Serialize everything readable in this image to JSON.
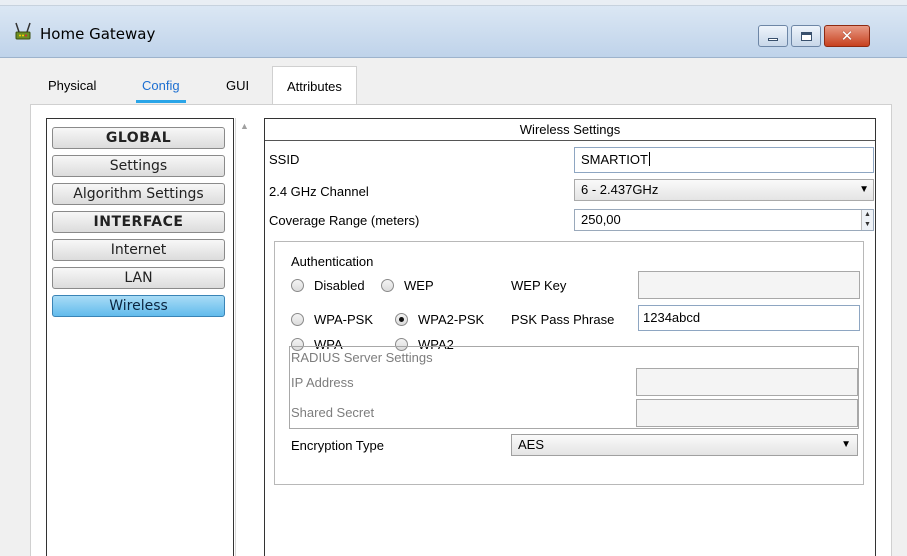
{
  "window": {
    "title": "Home Gateway",
    "icon": "router-icon",
    "controls": {
      "minimize": "minimize-icon",
      "maximize": "maximize-icon",
      "close": "✕"
    }
  },
  "tabs": [
    {
      "label": "Physical",
      "active": false
    },
    {
      "label": "Config",
      "active": true
    },
    {
      "label": "GUI",
      "active": false
    },
    {
      "label": "Attributes",
      "active": false
    }
  ],
  "sidebar": {
    "items": [
      {
        "label": "GLOBAL",
        "kind": "header"
      },
      {
        "label": "Settings",
        "kind": "item"
      },
      {
        "label": "Algorithm Settings",
        "kind": "item"
      },
      {
        "label": "INTERFACE",
        "kind": "header"
      },
      {
        "label": "Internet",
        "kind": "item"
      },
      {
        "label": "LAN",
        "kind": "item"
      },
      {
        "label": "Wireless",
        "kind": "item",
        "selected": true
      }
    ]
  },
  "wireless": {
    "header": "Wireless Settings",
    "ssid_label": "SSID",
    "ssid_value": "SMARTIOT",
    "channel_label": "2.4 GHz Channel",
    "channel_value": "6 - 2.437GHz",
    "coverage_label": "Coverage Range (meters)",
    "coverage_value": "250,00",
    "auth": {
      "title": "Authentication",
      "disabled": "Disabled",
      "wep": "WEP",
      "wep_key_label": "WEP Key",
      "wep_key_value": "",
      "wpa_psk": "WPA-PSK",
      "wpa2_psk": "WPA2-PSK",
      "psk_label": "PSK Pass Phrase",
      "psk_value": "1234abcd",
      "wpa": "WPA",
      "wpa2": "WPA2",
      "selected": "WPA2-PSK"
    },
    "radius": {
      "title": "RADIUS Server Settings",
      "ip_label": "IP Address",
      "ip_value": "",
      "secret_label": "Shared Secret",
      "secret_value": ""
    },
    "encryption_label": "Encryption Type",
    "encryption_value": "AES"
  },
  "colors": {
    "active_tab": "#1d6fd1",
    "tab_underline": "#2aa5e8",
    "selected_nav": "#62bbec",
    "close_button": "#c7411f"
  }
}
